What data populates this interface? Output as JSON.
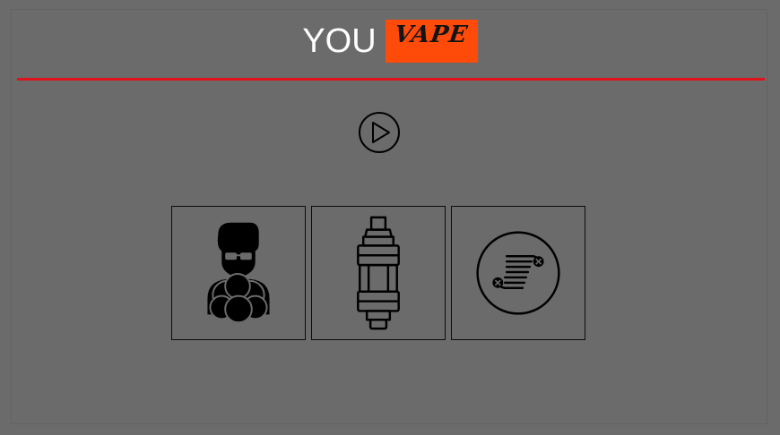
{
  "header": {
    "title_prefix": "YOU",
    "title_badge": "VAPE"
  },
  "colors": {
    "background": "#6b6b6b",
    "badge": "#ff4b09",
    "divider": "#e0121a",
    "icon": "#000000"
  },
  "controls": {
    "play_icon": "play-circle-icon"
  },
  "tiles": [
    {
      "icon": "vaper-smoke-icon"
    },
    {
      "icon": "tank-atomizer-icon"
    },
    {
      "icon": "coil-icon"
    }
  ]
}
